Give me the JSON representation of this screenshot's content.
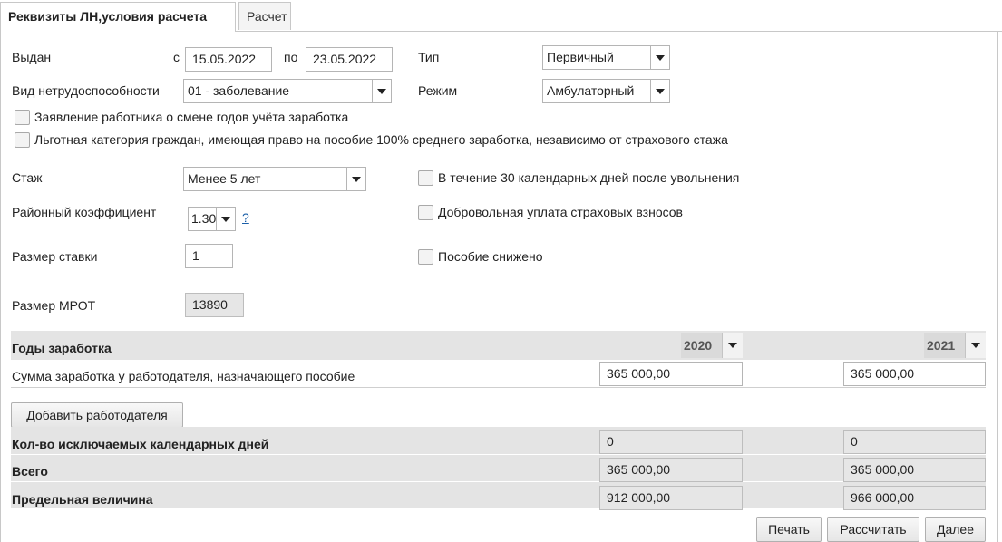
{
  "tabs": [
    "Реквизиты ЛН,условия расчета",
    "Расчет"
  ],
  "issued": {
    "label": "Выдан",
    "from_label": "с",
    "from_value": "15.05.2022",
    "to_label": "по",
    "to_value": "23.05.2022"
  },
  "type": {
    "label": "Тип",
    "value": "Первичный"
  },
  "disability": {
    "label": "Вид нетрудоспособности",
    "value": "01 - заболевание"
  },
  "mode": {
    "label": "Режим",
    "value": "Амбулаторный"
  },
  "checkboxes": {
    "change_years": "Заявление работника о смене годов учёта заработка",
    "benefit_category": "Льготная категория граждан, имеющая право на пособие 100% среднего заработка, независимо от страхового стажа",
    "after_dismissal": "В течение 30 календарных дней после увольнения",
    "voluntary": "Добровольная уплата страховых взносов",
    "reduced": "Пособие снижено"
  },
  "experience": {
    "label": "Стаж",
    "value": "Менее 5 лет"
  },
  "district_coef": {
    "label": "Районный коэффициент",
    "value": "1.30",
    "help": "?"
  },
  "rate": {
    "label": "Размер ставки",
    "value": "1"
  },
  "mrot": {
    "label": "Размер МРОТ",
    "value": "13890"
  },
  "earnings": {
    "header": "Годы заработка",
    "years": [
      "2020",
      "2021"
    ],
    "sum_label": "Сумма заработка у работодателя, назначающего пособие",
    "sum_values": [
      "365 000,00",
      "365 000,00"
    ]
  },
  "add_employer": "Добавить работодателя",
  "summary": {
    "excluded_label": "Кол-во исключаемых календарных дней",
    "excluded_values": [
      "0",
      "0"
    ],
    "total_label": "Всего",
    "total_values": [
      "365 000,00",
      "365 000,00"
    ],
    "limit_label": "Предельная величина",
    "limit_values": [
      "912 000,00",
      "966 000,00"
    ]
  },
  "buttons": {
    "print": "Печать",
    "calculate": "Рассчитать",
    "next": "Далее"
  }
}
